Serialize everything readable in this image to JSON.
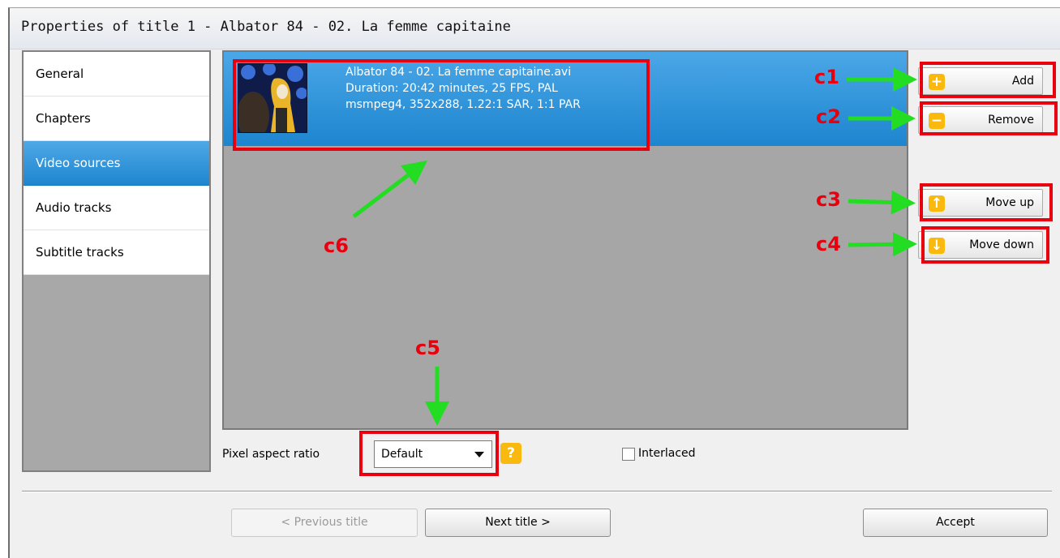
{
  "window": {
    "title": "Properties of title 1 - Albator 84 - 02. La femme capitaine"
  },
  "sidebar": {
    "items": [
      {
        "label": "General",
        "active": false
      },
      {
        "label": "Chapters",
        "active": false
      },
      {
        "label": "Video sources",
        "active": true
      },
      {
        "label": "Audio tracks",
        "active": false
      },
      {
        "label": "Subtitle tracks",
        "active": false
      }
    ]
  },
  "video_source": {
    "filename": "Albator 84 - 02. La femme capitaine.avi",
    "duration_line": "Duration: 20:42 minutes, 25 FPS, PAL",
    "codec_line": "msmpeg4, 352x288, 1.22:1 SAR, 1:1 PAR"
  },
  "buttons": {
    "add": "Add",
    "remove": "Remove",
    "move_up": "Move up",
    "move_down": "Move down",
    "previous": "< Previous title",
    "next": "Next title >",
    "accept": "Accept"
  },
  "icons": {
    "add": "plus-icon",
    "remove": "minus-icon",
    "move_up": "arrow-up-icon",
    "move_down": "arrow-down-icon",
    "help": "question-icon",
    "dropdown": "chevron-down-icon"
  },
  "form": {
    "pixel_aspect_ratio_label": "Pixel aspect ratio",
    "pixel_aspect_ratio_value": "Default",
    "help_glyph": "?",
    "interlaced_label": "Interlaced",
    "interlaced_checked": false
  },
  "annotations": {
    "c1": "c1",
    "c2": "c2",
    "c3": "c3",
    "c4": "c4",
    "c5": "c5",
    "c6": "c6"
  },
  "colors": {
    "selection_blue": "#1e86cf",
    "annotation_red": "#e8000e",
    "arrow_green": "#22dd22",
    "icon_yellow": "#f9b90f"
  }
}
